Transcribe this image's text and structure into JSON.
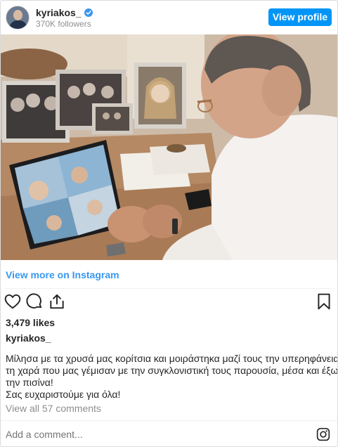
{
  "header": {
    "username": "kyriakos_",
    "followers": "370K followers",
    "view_profile_label": "View profile",
    "verified_icon": "verified-badge-icon"
  },
  "post": {
    "photo_alt": "",
    "view_more_label": "View more on Instagram",
    "likes": "3,479 likes",
    "caption_user": "kyriakos_",
    "caption_lines": [
      "Μίλησα με τα χρυσά μας κορίτσια και μοιράστηκα μαζί τους την υπερηφάνεια και",
      "τη χαρά που μας γέμισαν με την συγκλονιστική τους παρουσία, μέσα και έξω από",
      "την πισίνα!",
      "Σας ευχαριστούμε για όλα!"
    ],
    "view_comments_label": "View all 57 comments",
    "comment_placeholder": "Add a comment...",
    "icons": [
      "heart-icon",
      "comment-icon",
      "share-icon",
      "bookmark-icon",
      "instagram-icon"
    ]
  },
  "colors": {
    "accent": "#0095f6",
    "link": "#3897f0",
    "muted": "#8e8e8e",
    "text": "#262626"
  }
}
